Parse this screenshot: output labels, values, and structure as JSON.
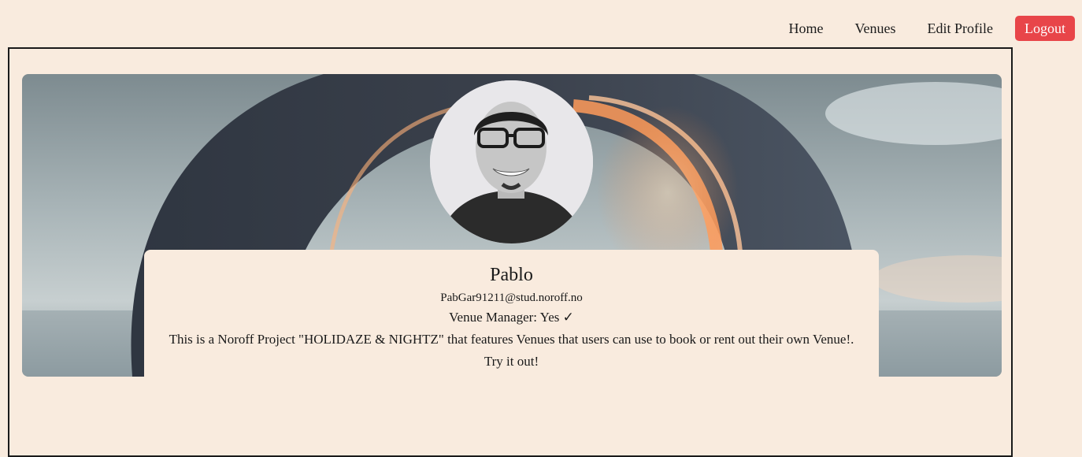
{
  "nav": {
    "home_label": "Home",
    "venues_label": "Venues",
    "edit_profile_label": "Edit Profile",
    "logout_label": "Logout"
  },
  "profile": {
    "name": "Pablo",
    "email": "PabGar91211@stud.noroff.no",
    "venue_manager": "Venue Manager: Yes ✓",
    "bio": "This is a Noroff Project \"HOLIDAZE & NIGHTZ\" that features Venues that users can use to book or rent out their own Venue!. Try it out!"
  },
  "colors": {
    "background": "#f9ebde",
    "logout_button": "#e84549",
    "border": "#1a1a1a"
  }
}
